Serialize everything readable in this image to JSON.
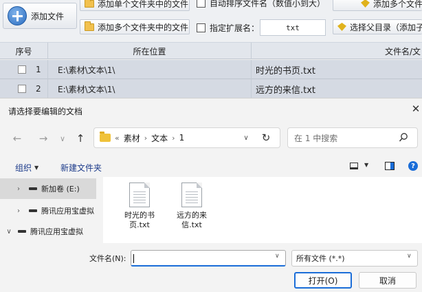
{
  "app": {
    "toolbar": {
      "add_file_label": "添加文件",
      "add_single_folder_label": "添加单个文件夹中的文件",
      "add_multi_folder_label": "添加多个文件夹中的文件",
      "auto_sort_label": "自动排序文件名（数值小到大）",
      "specify_ext_label": "指定扩展名：",
      "ext_value": "txt",
      "add_multi_right_label": "添加多个文件",
      "select_parent_label": "选择父目录（添加子"
    },
    "grid": {
      "columns": [
        "序号",
        "所在位置",
        "文件名/文"
      ],
      "rows": [
        {
          "index": "1",
          "location": "E:\\素材\\文本\\1\\",
          "filename": "时光的书页.txt"
        },
        {
          "index": "2",
          "location": "E:\\素材\\文本\\1\\",
          "filename": "远方的来信.txt"
        }
      ]
    }
  },
  "dialog": {
    "title": "请选择要编辑的文档",
    "close_glyph": "✕",
    "nav": {
      "back": "←",
      "forward": "→",
      "recent": "∨",
      "up": "↑"
    },
    "address": {
      "overflow": "«",
      "crumbs": [
        "素材",
        "文本",
        "1"
      ],
      "separator": "›",
      "dropdown": "∨",
      "refresh": "↻"
    },
    "search_placeholder": "在 1 中搜索",
    "commands": {
      "organize": "组织",
      "new_folder": "新建文件夹",
      "help": "?"
    },
    "tree": [
      {
        "chevron": "›",
        "label": "新加卷 (E:)"
      },
      {
        "chevron": "›",
        "label": "腾讯应用宝虚拟"
      },
      {
        "chevron": "∨",
        "label": "腾讯应用宝虚拟"
      }
    ],
    "files": [
      {
        "name": "时光的书页.txt"
      },
      {
        "name": "远方的来信.txt"
      }
    ],
    "filename_label": "文件名(N):",
    "filename_value": "",
    "filetype_value": "所有文件 (*.*)",
    "open_button": "打开(O)",
    "cancel_button": "取消"
  },
  "colors": {
    "accent": "#1a6dd8",
    "folder": "#f0c23a",
    "selection": "#d9d9d9"
  }
}
